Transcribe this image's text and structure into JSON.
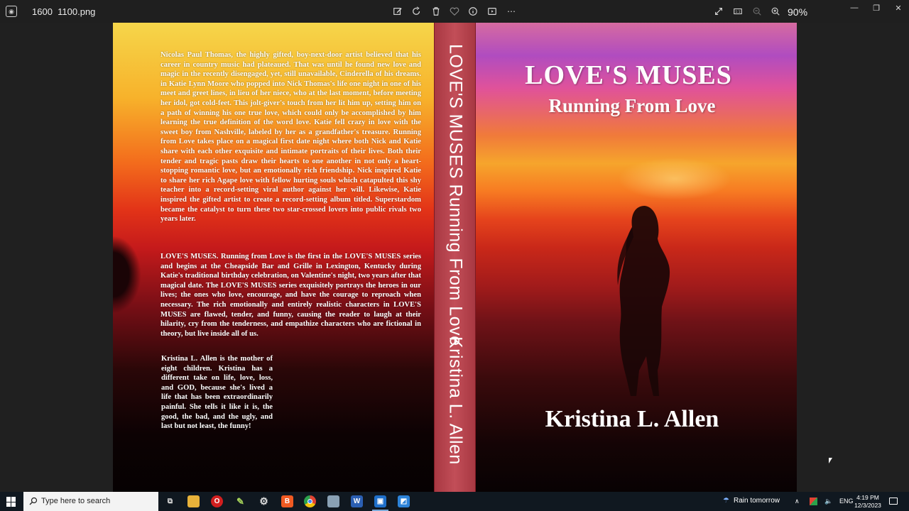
{
  "viewer": {
    "filename": "1600  1100.png",
    "zoom": "90%"
  },
  "book": {
    "back_p1": "Nicolas Paul Thomas, the highly gifted, boy-next-door artist believed that his career in country music had plateaued. That was until he found new love and magic in the recently disengaged, yet, still unavailable, Cinderella of his dreams. in Katie Lynn Moore who popped into Nick Thomas's life one night in one of his meet and greet lines, in lieu of her niece, who at the last moment, before meeting her idol, got cold-feet. This jolt-giver's touch from her lit him up, setting him on a path of winning his one true love, which could only be accomplished by him learning the true definition of the word love. Katie fell crazy in love with the sweet boy from Nashville, labeled by her as a grandfather's treasure. Running from Love takes place on a magical first date night where both Nick and Katie share with each other exquisite and intimate portraits of their lives. Both their tender and tragic pasts draw their hearts to one another in not only a heart-stopping romantic love, but an emotionally rich friendship. Nick inspired Katie to share her rich Agape love with fellow hurting souls which catapulted this shy teacher into a record-setting viral author against her will. Likewise, Katie inspired the gifted artist to create a record-setting album titled. Superstardom became the catalyst to turn these two star-crossed lovers into public rivals two years later.",
    "back_p2": "LOVE'S MUSES. Running from Love is the first in the LOVE'S MUSES series and begins at the Cheapside Bar and Grille in Lexington, Kentucky during Katie's traditional birthday celebration, on Valentine's night, two years after that magical date. The LOVE'S MUSES series exquisitely portrays the heroes in our lives; the ones who love, encourage, and have the courage to reproach when necessary. The rich emotionally and entirely realistic characters in LOVE'S MUSES are flawed, tender, and funny, causing the reader to laugh at their hilarity, cry from the tenderness, and empathize characters who are fictional in theory, but live inside all of us.",
    "back_bio": "Kristina L. Allen is the mother of eight children. Kristina has a different take on life, love, loss, and GOD, because she's lived a life that has been extraordinarily painful. She tells it like it is, the good, the bad, and the ugly, and last but not least, the funny!",
    "spine_title": "LOVE'S MUSES  Running From Love",
    "spine_author": "Kristina L. Allen",
    "front_title": "LOVE'S MUSES",
    "front_subtitle": "Running From Love",
    "front_author": "Kristina L. Allen"
  },
  "taskbar": {
    "search_placeholder": "Type here to search",
    "weather": "Rain tomorrow",
    "language": "ENG",
    "time": "4:19 PM",
    "date": "12/3/2023"
  }
}
